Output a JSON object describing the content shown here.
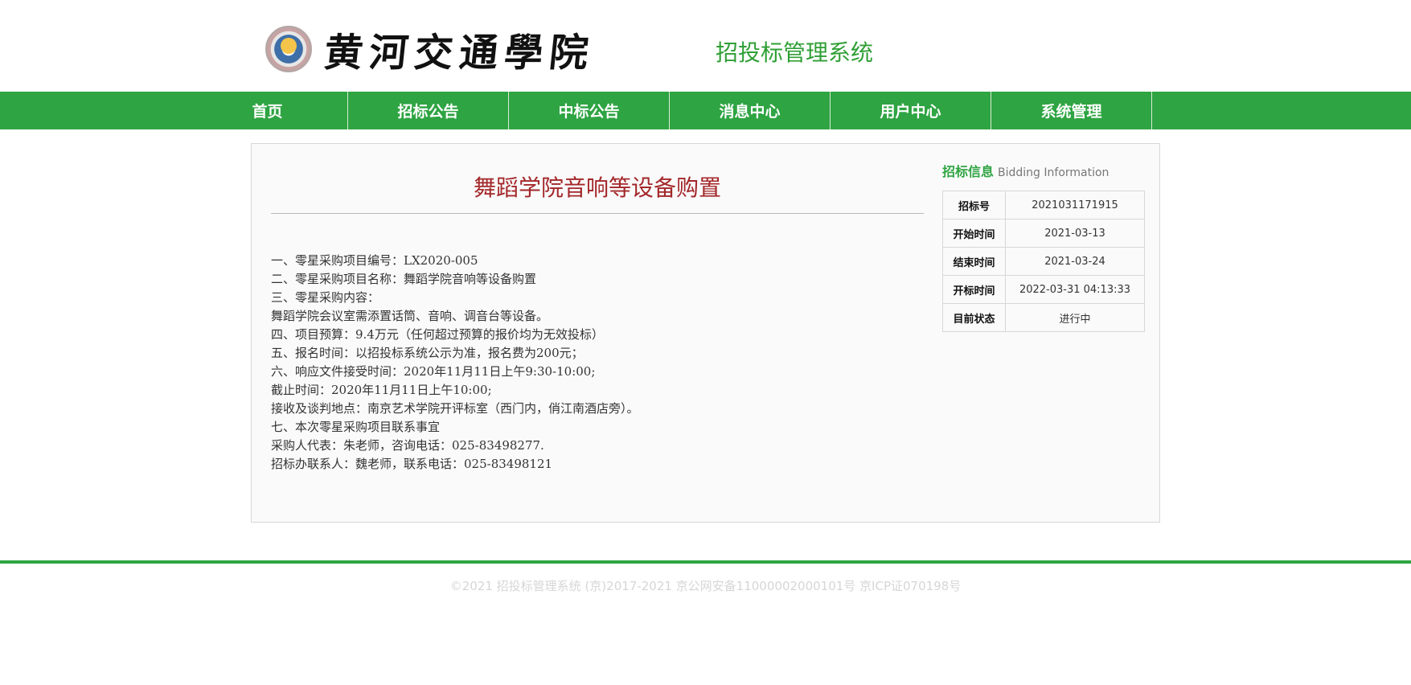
{
  "header": {
    "school_name": "黄河交通學院",
    "system_title": "招投标管理系统",
    "logo_icon": "school-seal-icon"
  },
  "nav": {
    "items": [
      {
        "label": "首页"
      },
      {
        "label": "招标公告"
      },
      {
        "label": "中标公告"
      },
      {
        "label": "消息中心"
      },
      {
        "label": "用户中心"
      },
      {
        "label": "系统管理"
      }
    ]
  },
  "article": {
    "title": "舞蹈学院音响等设备购置",
    "lines": [
      "一、零星采购项目编号：LX2020-005",
      "二、零星采购项目名称：舞蹈学院音响等设备购置",
      "三、零星采购内容：",
      "舞蹈学院会议室需添置话筒、音响、调音台等设备。",
      "四、项目预算：9.4万元（任何超过预算的报价均为无效投标）",
      "五、报名时间：以招投标系统公示为准，报名费为200元；",
      "六、响应文件接受时间：2020年11月11日上午9:30-10:00;",
      "截止时间：2020年11月11日上午10:00;",
      "接收及谈判地点：南京艺术学院开评标室（西门内，俏江南酒店旁）。",
      "七、本次零星采购项目联系事宜",
      "采购人代表：朱老师，咨询电话：025-83498277.",
      "招标办联系人：魏老师，联系电话：025-83498121"
    ]
  },
  "bidding_info": {
    "title_cn": "招标信息",
    "title_en": "Bidding Information",
    "rows": [
      {
        "key": "招标号",
        "value": "2021031171915"
      },
      {
        "key": "开始时间",
        "value": "2021-03-13"
      },
      {
        "key": "结束时间",
        "value": "2021-03-24"
      },
      {
        "key": "开标时间",
        "value": "2022-03-31 04:13:33"
      },
      {
        "key": "目前状态",
        "value": "进行中"
      }
    ]
  },
  "footer": {
    "text": "©2021 招投标管理系统 (京)2017-2021 京公网安备11000002000101号 京ICP证070198号"
  }
}
